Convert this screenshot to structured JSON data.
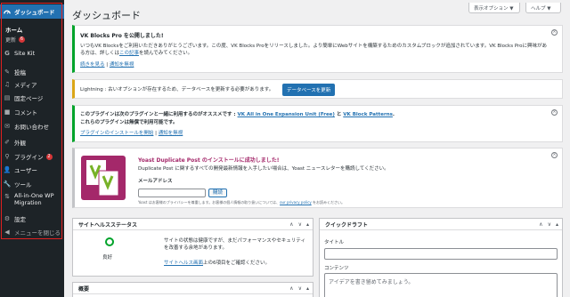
{
  "sidebar": {
    "dashboard": "ダッシュボード",
    "home": "ホーム",
    "updates": "更新",
    "updates_count": "6",
    "site_kit": "Site Kit",
    "posts": "投稿",
    "media": "メディア",
    "pages": "固定ページ",
    "comments": "コメント",
    "contact": "お問い合わせ",
    "appearance": "外観",
    "plugins": "プラグイン",
    "plugins_count": "2",
    "users": "ユーザー",
    "tools": "ツール",
    "migration": "All-in-One WP Migration",
    "settings": "設定",
    "collapse": "メニューを閉じる"
  },
  "header": {
    "title": "ダッシュボード",
    "screen_options": "表示オプション ▼",
    "help": "ヘルプ ▼"
  },
  "notice_vk": {
    "title": "VK Blocks Pro を公開しました!",
    "text1": "いつもVK Blocksをご利用いただきありがとうございます。この度、VK Blocks Proをリリースしました。より簡単にWebサイトを構築するためのカスタムブロックが追加されています。VK Blocks Proに",
    "text2_prefix": "興味がある方は、詳しくは",
    "text2_link": "この記事",
    "text2_suffix": "を読んでみてください。",
    "read_more": "続きを見る",
    "separator": " | ",
    "dismiss": "通知を無視"
  },
  "notice_lightning": {
    "text": "Lightning : 古いオプションが存在するため、データベースを更新する必要があります。",
    "button": "データベースを更新"
  },
  "notice_plugins": {
    "line1_prefix": "このプラグインは次のプラグインと一緒に利用するのがオススメです : ",
    "plugin1": "VK All in One Expansion Unit (Free)",
    "and": " と ",
    "plugin2": "VK Block Patterns",
    "period": ".",
    "line2": "これらのプラグインは無償で利用可能です。",
    "install": "プラグインのインストールを開始",
    "separator": " | ",
    "dismiss": "通知を無視"
  },
  "yoast": {
    "title": "Yoast Duplicate Post のインストールに成功しました!",
    "text": "Duplicate Post に関するすべての開発最新情報を入手したい場合は、Yoast ニュースレターを購読してください。",
    "email_label": "メールアドレス",
    "subscribe": "購読",
    "privacy_prefix": "Yoast はお客様のプライバシーを尊重します。お客様の個人情報の取り扱いについては、",
    "privacy_link": "our privacy policy",
    "privacy_suffix": " をお読みください。"
  },
  "site_health": {
    "title": "サイトヘルスステータス",
    "status": "良好",
    "text": "サイトの状態は健康ですが、まだパフォーマンスやセキュリティを改善する余地があります。",
    "link": "サイトヘルス画面",
    "link_suffix": "上の6項目をご確認ください。"
  },
  "quick_draft": {
    "title": "クイックドラフト",
    "title_label": "タイトル",
    "content_label": "コンテンツ",
    "content_placeholder": "アイデアを書き留めてみましょう。"
  },
  "overview": {
    "title": "概要"
  },
  "colors": {
    "sidebar_bg": "#1d2327",
    "accent": "#2271b1",
    "yoast": "#a4286a",
    "success": "#00a32a",
    "warning": "#dba617"
  }
}
